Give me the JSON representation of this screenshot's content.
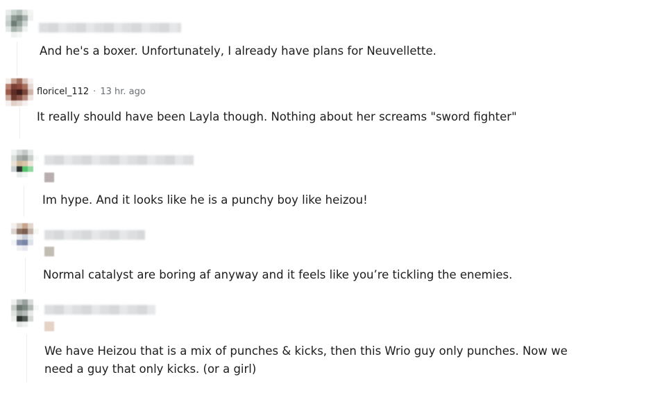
{
  "comments": [
    {
      "username": "",
      "time": "",
      "body": "And he's a boxer. Unfortunately, I already have plans for Neuvellette."
    },
    {
      "username": "floricel_112",
      "separator": "·",
      "time": "13 hr. ago",
      "body": "It really should have been Layla though. Nothing about her screams \"sword fighter\""
    },
    {
      "username": "",
      "time": "",
      "body": "Im hype. And it looks like he is a punchy boy like heizou!"
    },
    {
      "username": "",
      "time": "",
      "body": "Normal catalyst are boring af anyway and it feels like you’re tickling the enemies."
    },
    {
      "username": "",
      "time": "",
      "body": "We have Heizou that is a mix of punches & kicks, then this Wrio guy only punches. Now we need a guy that only kicks. (or a girl)"
    }
  ],
  "colors": {
    "text": "#1c1c1c",
    "meta": "#6b6f72",
    "thread_line": "#eceeef"
  }
}
